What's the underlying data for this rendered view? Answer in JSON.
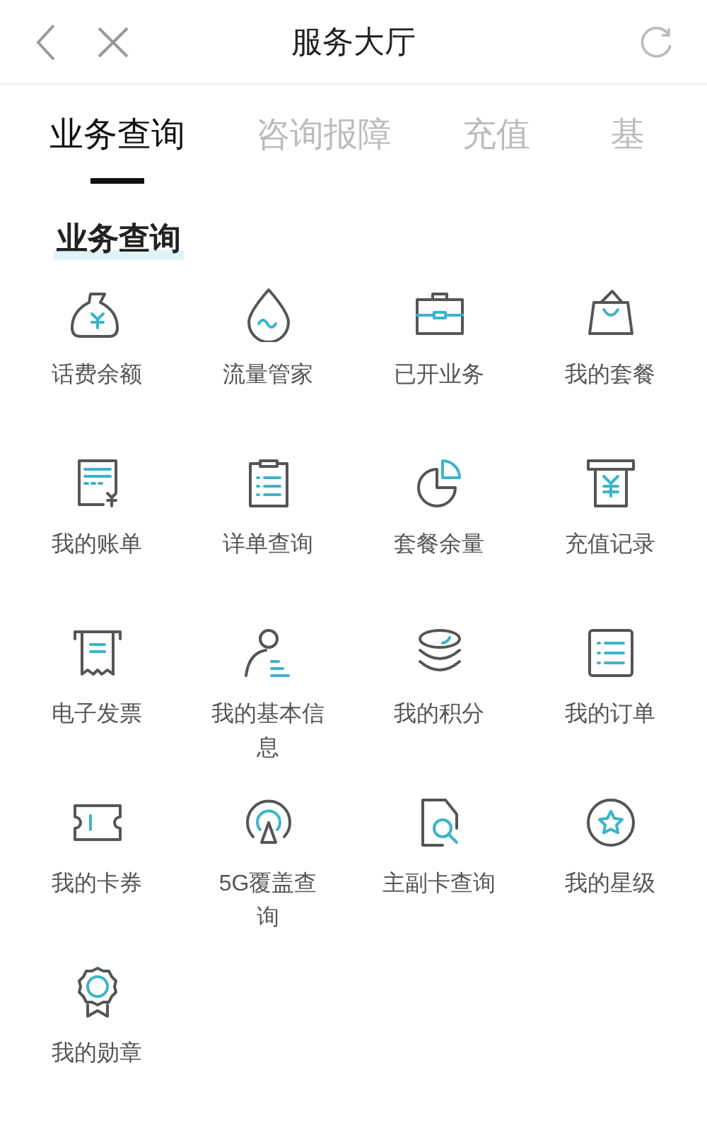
{
  "header": {
    "title": "服务大厅"
  },
  "tabs": [
    {
      "label": "业务查询",
      "selected": true
    },
    {
      "label": "咨询报障",
      "selected": false
    },
    {
      "label": "充值",
      "selected": false
    },
    {
      "label": "基",
      "selected": false
    }
  ],
  "section": {
    "title": "业务查询"
  },
  "items": [
    {
      "label": "话费余额",
      "kind": "money-bag"
    },
    {
      "label": "流量管家",
      "kind": "drop"
    },
    {
      "label": "已开业务",
      "kind": "briefcase"
    },
    {
      "label": "我的套餐",
      "kind": "bag"
    },
    {
      "label": "我的账单",
      "kind": "bill"
    },
    {
      "label": "详单查询",
      "kind": "clipboard"
    },
    {
      "label": "套餐余量",
      "kind": "pie"
    },
    {
      "label": "充值记录",
      "kind": "atm"
    },
    {
      "label": "电子发票",
      "kind": "receipt"
    },
    {
      "label": "我的基本信息",
      "kind": "person"
    },
    {
      "label": "我的积分",
      "kind": "coins"
    },
    {
      "label": "我的订单",
      "kind": "list"
    },
    {
      "label": "我的卡券",
      "kind": "ticket"
    },
    {
      "label": "5G覆盖查询",
      "kind": "signal"
    },
    {
      "label": "主副卡查询",
      "kind": "sim-search"
    },
    {
      "label": "我的星级",
      "kind": "star"
    },
    {
      "label": "我的勋章",
      "kind": "medal"
    }
  ]
}
